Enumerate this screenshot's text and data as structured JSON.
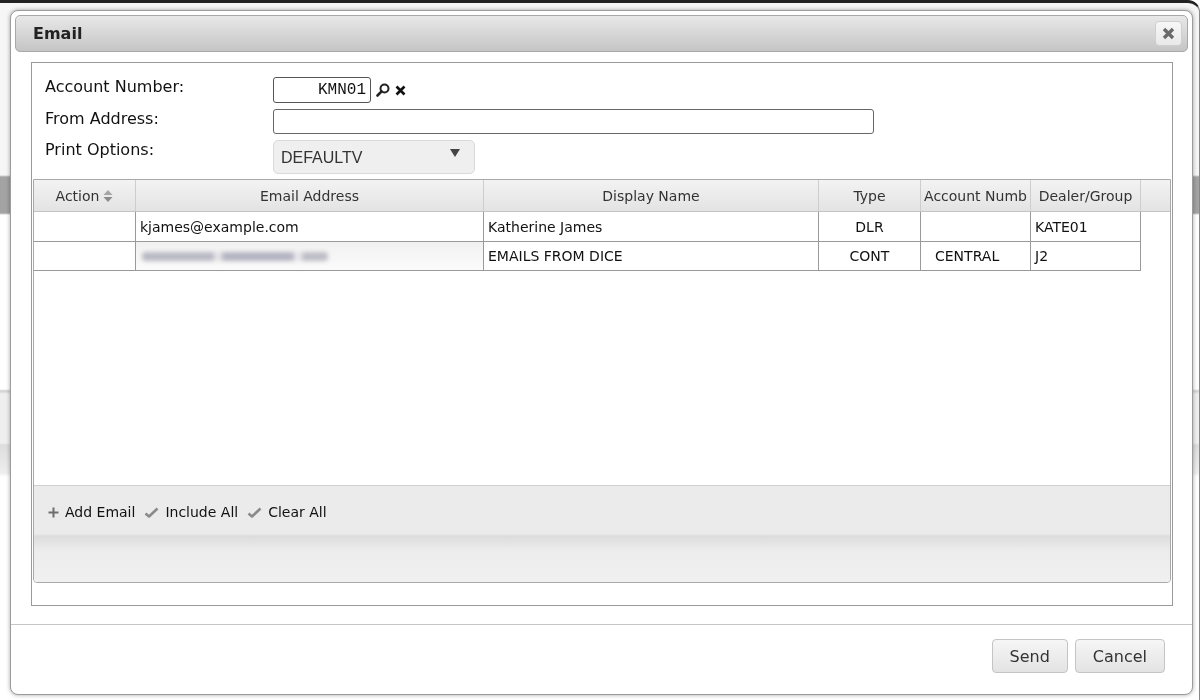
{
  "dialog": {
    "title": "Email",
    "form": {
      "fields": [
        {
          "kind": "lookup",
          "label": "Account Number:",
          "value": "KMN01"
        },
        {
          "kind": "text",
          "label": "From Address:"
        },
        {
          "kind": "select",
          "label": "Print Options:",
          "value": "DEFAULTV"
        }
      ]
    },
    "grid": {
      "columns": [
        {
          "label": "Action",
          "sortable": true
        },
        {
          "label": "Email Address",
          "sortable": false
        },
        {
          "label": "Display Name",
          "sortable": false
        },
        {
          "label": "Type",
          "sortable": false
        },
        {
          "label": "Account Numb",
          "sortable": false
        },
        {
          "label": "Dealer/Group",
          "sortable": false
        }
      ],
      "rows": [
        {
          "email": "kjames@example.com",
          "email_blurred": false,
          "display_name": "Katherine James",
          "type": "DLR",
          "dealer_group": "KATE01"
        },
        {
          "email_blurred": true,
          "display_name": "EMAILS FROM DICE",
          "type": "CONT",
          "account_number": "CENTRAL",
          "dealer_group": "J2"
        }
      ],
      "toolbar": [
        {
          "kind": "add",
          "label": "Add Email"
        },
        {
          "kind": "check",
          "label": "Include All"
        },
        {
          "kind": "check",
          "label": "Clear All"
        }
      ]
    },
    "buttons": [
      "Send",
      "Cancel"
    ]
  }
}
